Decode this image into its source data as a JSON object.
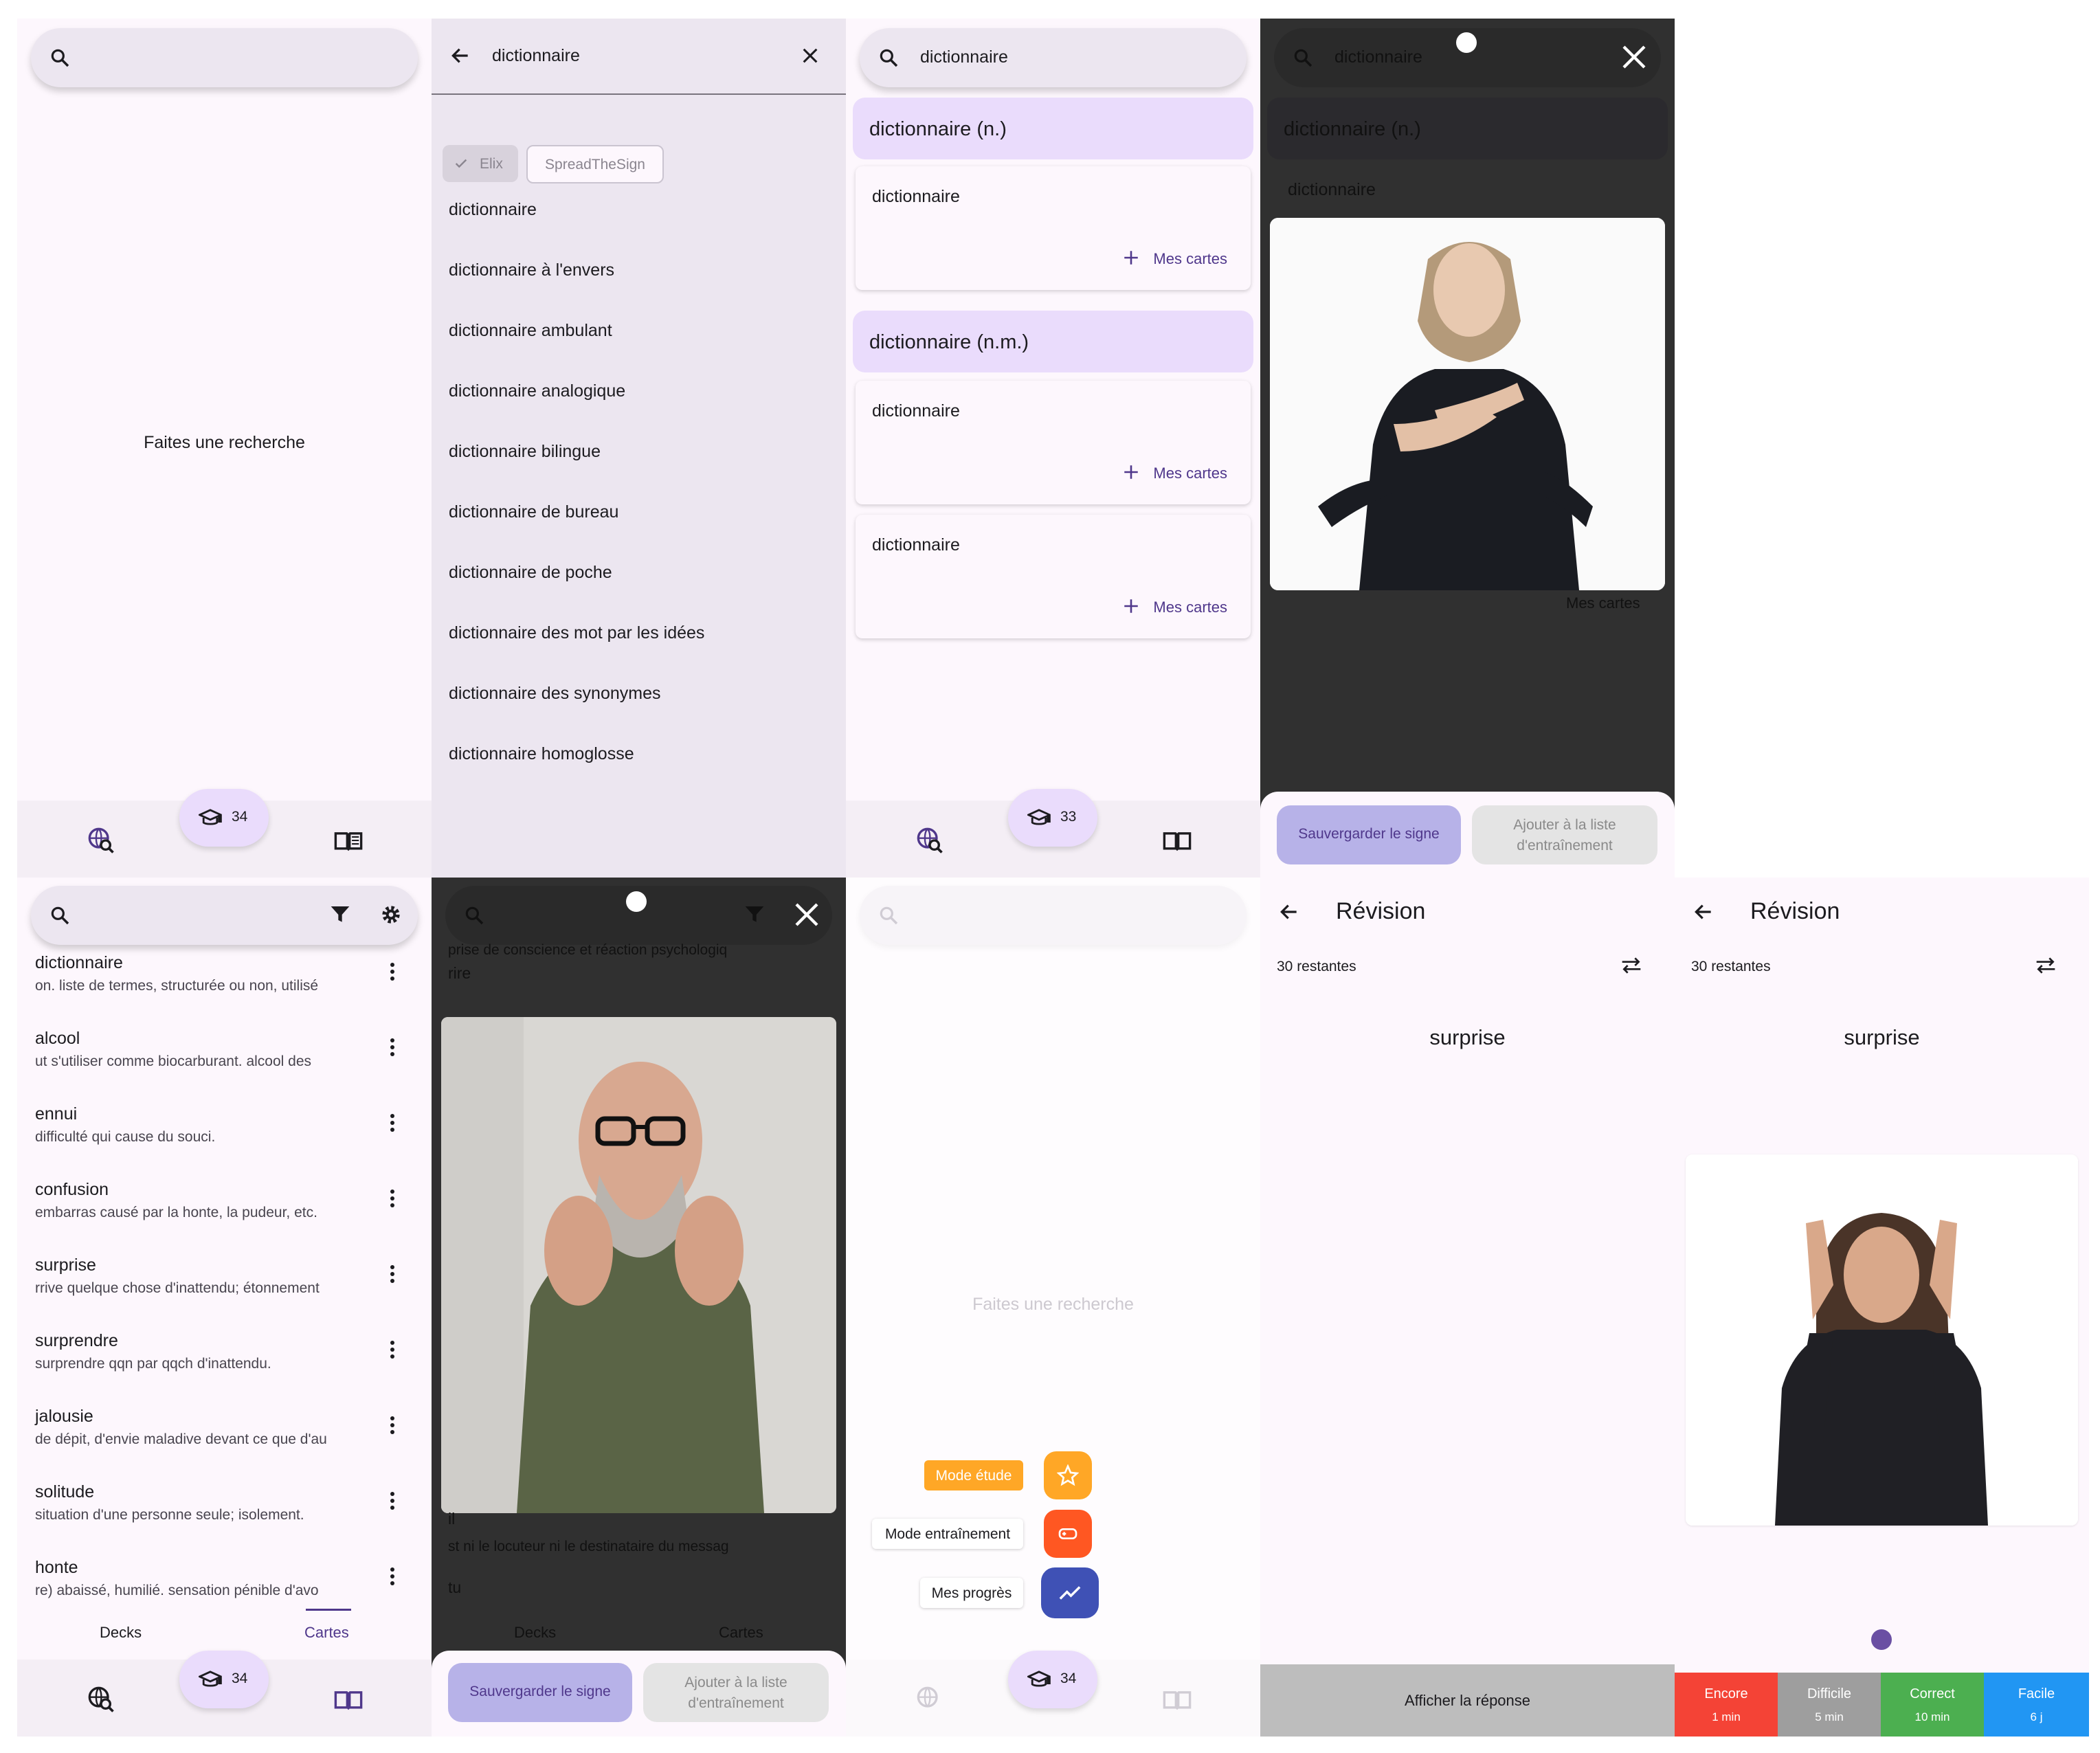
{
  "colors": {
    "panel_bg": "#fdf7fd",
    "accent": "#eadcfc",
    "primary": "#4f378b",
    "dark": "#303030"
  },
  "panel1": {
    "empty_text": "Faites une recherche",
    "badge_count": "34"
  },
  "panel2": {
    "query": "dictionnaire",
    "chips": [
      {
        "label": "Elix",
        "selected": true
      },
      {
        "label": "SpreadTheSign",
        "selected": false
      }
    ],
    "suggestions": [
      "dictionnaire",
      "dictionnaire à l'envers",
      "dictionnaire ambulant",
      "dictionnaire analogique",
      "dictionnaire bilingue",
      "dictionnaire de bureau",
      "dictionnaire de poche",
      "dictionnaire des mot par les idées",
      "dictionnaire des synonymes",
      "dictionnaire homoglosse"
    ]
  },
  "panel3": {
    "query": "dictionnaire",
    "groups": [
      {
        "header": "dictionnaire (n.)",
        "cards": [
          {
            "word": "dictionnaire",
            "action": "Mes cartes"
          }
        ]
      },
      {
        "header": "dictionnaire (n.m.)",
        "cards": [
          {
            "word": "dictionnaire",
            "action": "Mes cartes"
          },
          {
            "word": "dictionnaire",
            "action": "Mes cartes"
          }
        ]
      }
    ],
    "badge_count": "33"
  },
  "panel4": {
    "query": "dictionnaire",
    "header": "dictionnaire (n.)",
    "word": "dictionnaire",
    "action": "Mes cartes",
    "save_label": "Sauvergarder le signe",
    "add_label": "Ajouter à la liste d'entraînement"
  },
  "panel5": {
    "rows": [
      {
        "word": "dictionnaire",
        "def": "on. liste de termes, structurée ou non, utilisé"
      },
      {
        "word": "alcool",
        "def": "ut s'utiliser comme biocarburant. alcool des"
      },
      {
        "word": "ennui",
        "def": "difficulté qui cause du souci."
      },
      {
        "word": "confusion",
        "def": "embarras causé par la honte, la pudeur, etc."
      },
      {
        "word": "surprise",
        "def": "rrive quelque chose d'inattendu; étonnement"
      },
      {
        "word": "surprendre",
        "def": "surprendre qqn par qqch d'inattendu."
      },
      {
        "word": "jalousie",
        "def": "de dépit, d'envie maladive devant ce que d'au"
      },
      {
        "word": "solitude",
        "def": "situation d'une personne seule; isolement."
      },
      {
        "word": "honte",
        "def": "re) abaissé, humilié. sensation pénible d'avo"
      }
    ],
    "tabs": [
      "Decks",
      "Cartes"
    ],
    "badge_count": "34"
  },
  "panel6": {
    "top_def": "prise de conscience et réaction psychologiq",
    "top_word": "rire",
    "bottom_word": "il",
    "bottom_def": "st ni le locuteur ni le destinataire du messag",
    "bottom_word2": "tu",
    "tabs": [
      "Decks",
      "Cartes"
    ],
    "save_label": "Sauvergarder le signe",
    "add_label": "Ajouter à la liste d'entraînement"
  },
  "panel7": {
    "empty_text": "Faites une recherche",
    "menu": [
      {
        "label": "Mode étude",
        "color": "#ffa726",
        "icon": "star-icon"
      },
      {
        "label": "Mode entraînement",
        "color": "#ff5722",
        "icon": "gamepad-icon"
      },
      {
        "label": "Mes progrès",
        "color": "#3f51b5",
        "icon": "trending-icon"
      }
    ],
    "badge_count": "34"
  },
  "panel8": {
    "title": "Révision",
    "remaining": "30 restantes",
    "word": "surprise",
    "show_answer": "Afficher la réponse"
  },
  "panel9": {
    "title": "Révision",
    "remaining": "30 restantes",
    "word": "surprise",
    "grades": [
      {
        "label": "Encore",
        "time": "1 min",
        "color": "#f44336"
      },
      {
        "label": "Difficile",
        "time": "5 min",
        "color": "#9e9e9e"
      },
      {
        "label": "Correct",
        "time": "10 min",
        "color": "#4caf50"
      },
      {
        "label": "Facile",
        "time": "6 j",
        "color": "#2196f3"
      }
    ]
  }
}
